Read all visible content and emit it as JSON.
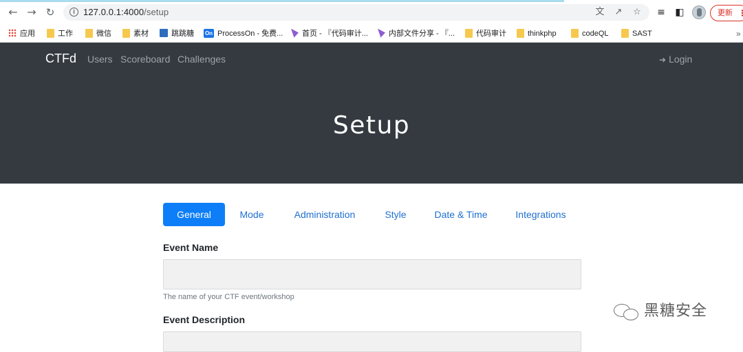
{
  "browser": {
    "url_host": "127.0.0.1:4000",
    "url_path": "/setup",
    "update_label": "更新",
    "bookmarks": [
      {
        "label": "应用",
        "icon": "apps-grid-icon"
      },
      {
        "label": "工作",
        "icon": "folder-icon"
      },
      {
        "label": "微信",
        "icon": "folder-icon"
      },
      {
        "label": "素材",
        "icon": "folder-icon"
      },
      {
        "label": "跳跳糖",
        "icon": "table-icon"
      },
      {
        "label": "ProcessOn - 免费...",
        "icon": "processon-icon"
      },
      {
        "label": "首页 - 『代码审计...",
        "icon": "bookmark-page-icon"
      },
      {
        "label": "内部文件分享 - 『...",
        "icon": "bookmark-page-icon"
      },
      {
        "label": "代码审计",
        "icon": "folder-icon"
      },
      {
        "label": "thinkphp",
        "icon": "folder-icon"
      },
      {
        "label": "codeQL",
        "icon": "folder-icon"
      },
      {
        "label": "SAST",
        "icon": "folder-icon"
      }
    ],
    "more_bookmarks": "»"
  },
  "navbar": {
    "brand": "CTFd",
    "links": [
      "Users",
      "Scoreboard",
      "Challenges"
    ],
    "login": "Login"
  },
  "jumbotron": {
    "title": "Setup"
  },
  "tabs": [
    {
      "label": "General",
      "active": true
    },
    {
      "label": "Mode",
      "active": false
    },
    {
      "label": "Administration",
      "active": false
    },
    {
      "label": "Style",
      "active": false
    },
    {
      "label": "Date & Time",
      "active": false
    },
    {
      "label": "Integrations",
      "active": false
    }
  ],
  "form": {
    "event_name_label": "Event Name",
    "event_name_value": "",
    "event_name_help": "The name of your CTF event/workshop",
    "event_description_label": "Event Description"
  },
  "watermark": "黑糖安全",
  "colors": {
    "navbar_bg": "#343a40",
    "active_tab": "#0d7ef7",
    "link": "#1f6fd0",
    "update_red": "#d93025"
  }
}
